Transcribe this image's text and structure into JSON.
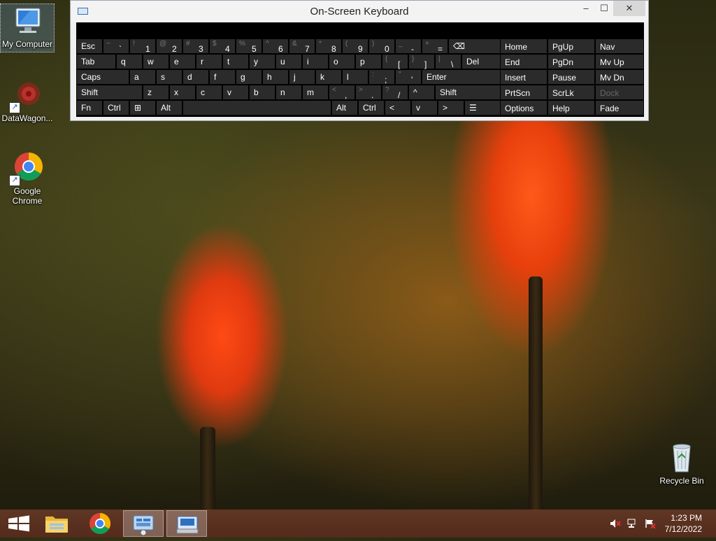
{
  "desktop": {
    "icons": [
      {
        "label": "My Computer"
      },
      {
        "label": "DataWagon..."
      },
      {
        "label": "Google Chrome"
      },
      {
        "label": "Recycle Bin"
      }
    ]
  },
  "osk": {
    "title": "On-Screen Keyboard",
    "window_controls": {
      "minimize": "–",
      "maximize": "☐",
      "close": "✕"
    },
    "rows": [
      [
        {
          "main": "Esc"
        },
        {
          "shift": "~",
          "low": "`"
        },
        {
          "shift": "!",
          "low": "1"
        },
        {
          "shift": "@",
          "low": "2"
        },
        {
          "shift": "#",
          "low": "3"
        },
        {
          "shift": "$",
          "low": "4"
        },
        {
          "shift": "%",
          "low": "5"
        },
        {
          "shift": "^",
          "low": "6"
        },
        {
          "shift": "&",
          "low": "7"
        },
        {
          "shift": "*",
          "low": "8"
        },
        {
          "shift": "(",
          "low": "9"
        },
        {
          "shift": ")",
          "low": "0"
        },
        {
          "shift": "_",
          "low": "-"
        },
        {
          "shift": "+",
          "low": "="
        },
        {
          "main": "⌫"
        }
      ],
      [
        {
          "main": "Tab"
        },
        {
          "main": "q"
        },
        {
          "main": "w"
        },
        {
          "main": "e"
        },
        {
          "main": "r"
        },
        {
          "main": "t"
        },
        {
          "main": "y"
        },
        {
          "main": "u"
        },
        {
          "main": "i"
        },
        {
          "main": "o"
        },
        {
          "main": "p"
        },
        {
          "shift": "{",
          "low": "["
        },
        {
          "shift": "}",
          "low": "]"
        },
        {
          "shift": "|",
          "low": "\\"
        },
        {
          "main": "Del"
        }
      ],
      [
        {
          "main": "Caps"
        },
        {
          "main": "a"
        },
        {
          "main": "s"
        },
        {
          "main": "d"
        },
        {
          "main": "f"
        },
        {
          "main": "g"
        },
        {
          "main": "h"
        },
        {
          "main": "j"
        },
        {
          "main": "k"
        },
        {
          "main": "l"
        },
        {
          "shift": ":",
          "low": ";"
        },
        {
          "shift": "\"",
          "low": "'"
        },
        {
          "main": "Enter"
        }
      ],
      [
        {
          "main": "Shift"
        },
        {
          "main": "z"
        },
        {
          "main": "x"
        },
        {
          "main": "c"
        },
        {
          "main": "v"
        },
        {
          "main": "b"
        },
        {
          "main": "n"
        },
        {
          "main": "m"
        },
        {
          "shift": "<",
          "low": ","
        },
        {
          "shift": ">",
          "low": "."
        },
        {
          "shift": "?",
          "low": "/"
        },
        {
          "main": "^"
        },
        {
          "main": "Shift"
        }
      ],
      [
        {
          "main": "Fn"
        },
        {
          "main": "Ctrl"
        },
        {
          "main": "⊞"
        },
        {
          "main": "Alt"
        },
        {
          "main": ""
        },
        {
          "main": "Alt"
        },
        {
          "main": "Ctrl"
        },
        {
          "main": "<"
        },
        {
          "main": "v"
        },
        {
          "main": ">"
        },
        {
          "main": "☰"
        }
      ]
    ],
    "nav_keys": [
      [
        "Home",
        "PgUp",
        "Nav"
      ],
      [
        "End",
        "PgDn",
        "Mv Up"
      ],
      [
        "Insert",
        "Pause",
        "Mv Dn"
      ],
      [
        "PrtScn",
        "ScrLk",
        "Dock"
      ],
      [
        "Options",
        "Help",
        "Fade"
      ]
    ],
    "disabled_keys": [
      "Dock"
    ]
  },
  "taskbar": {
    "apps": [
      "start",
      "file-explorer",
      "google-chrome",
      "server-manager",
      "on-screen-keyboard"
    ],
    "clock": {
      "time": "1:23 PM",
      "date": "7/12/2022"
    }
  }
}
